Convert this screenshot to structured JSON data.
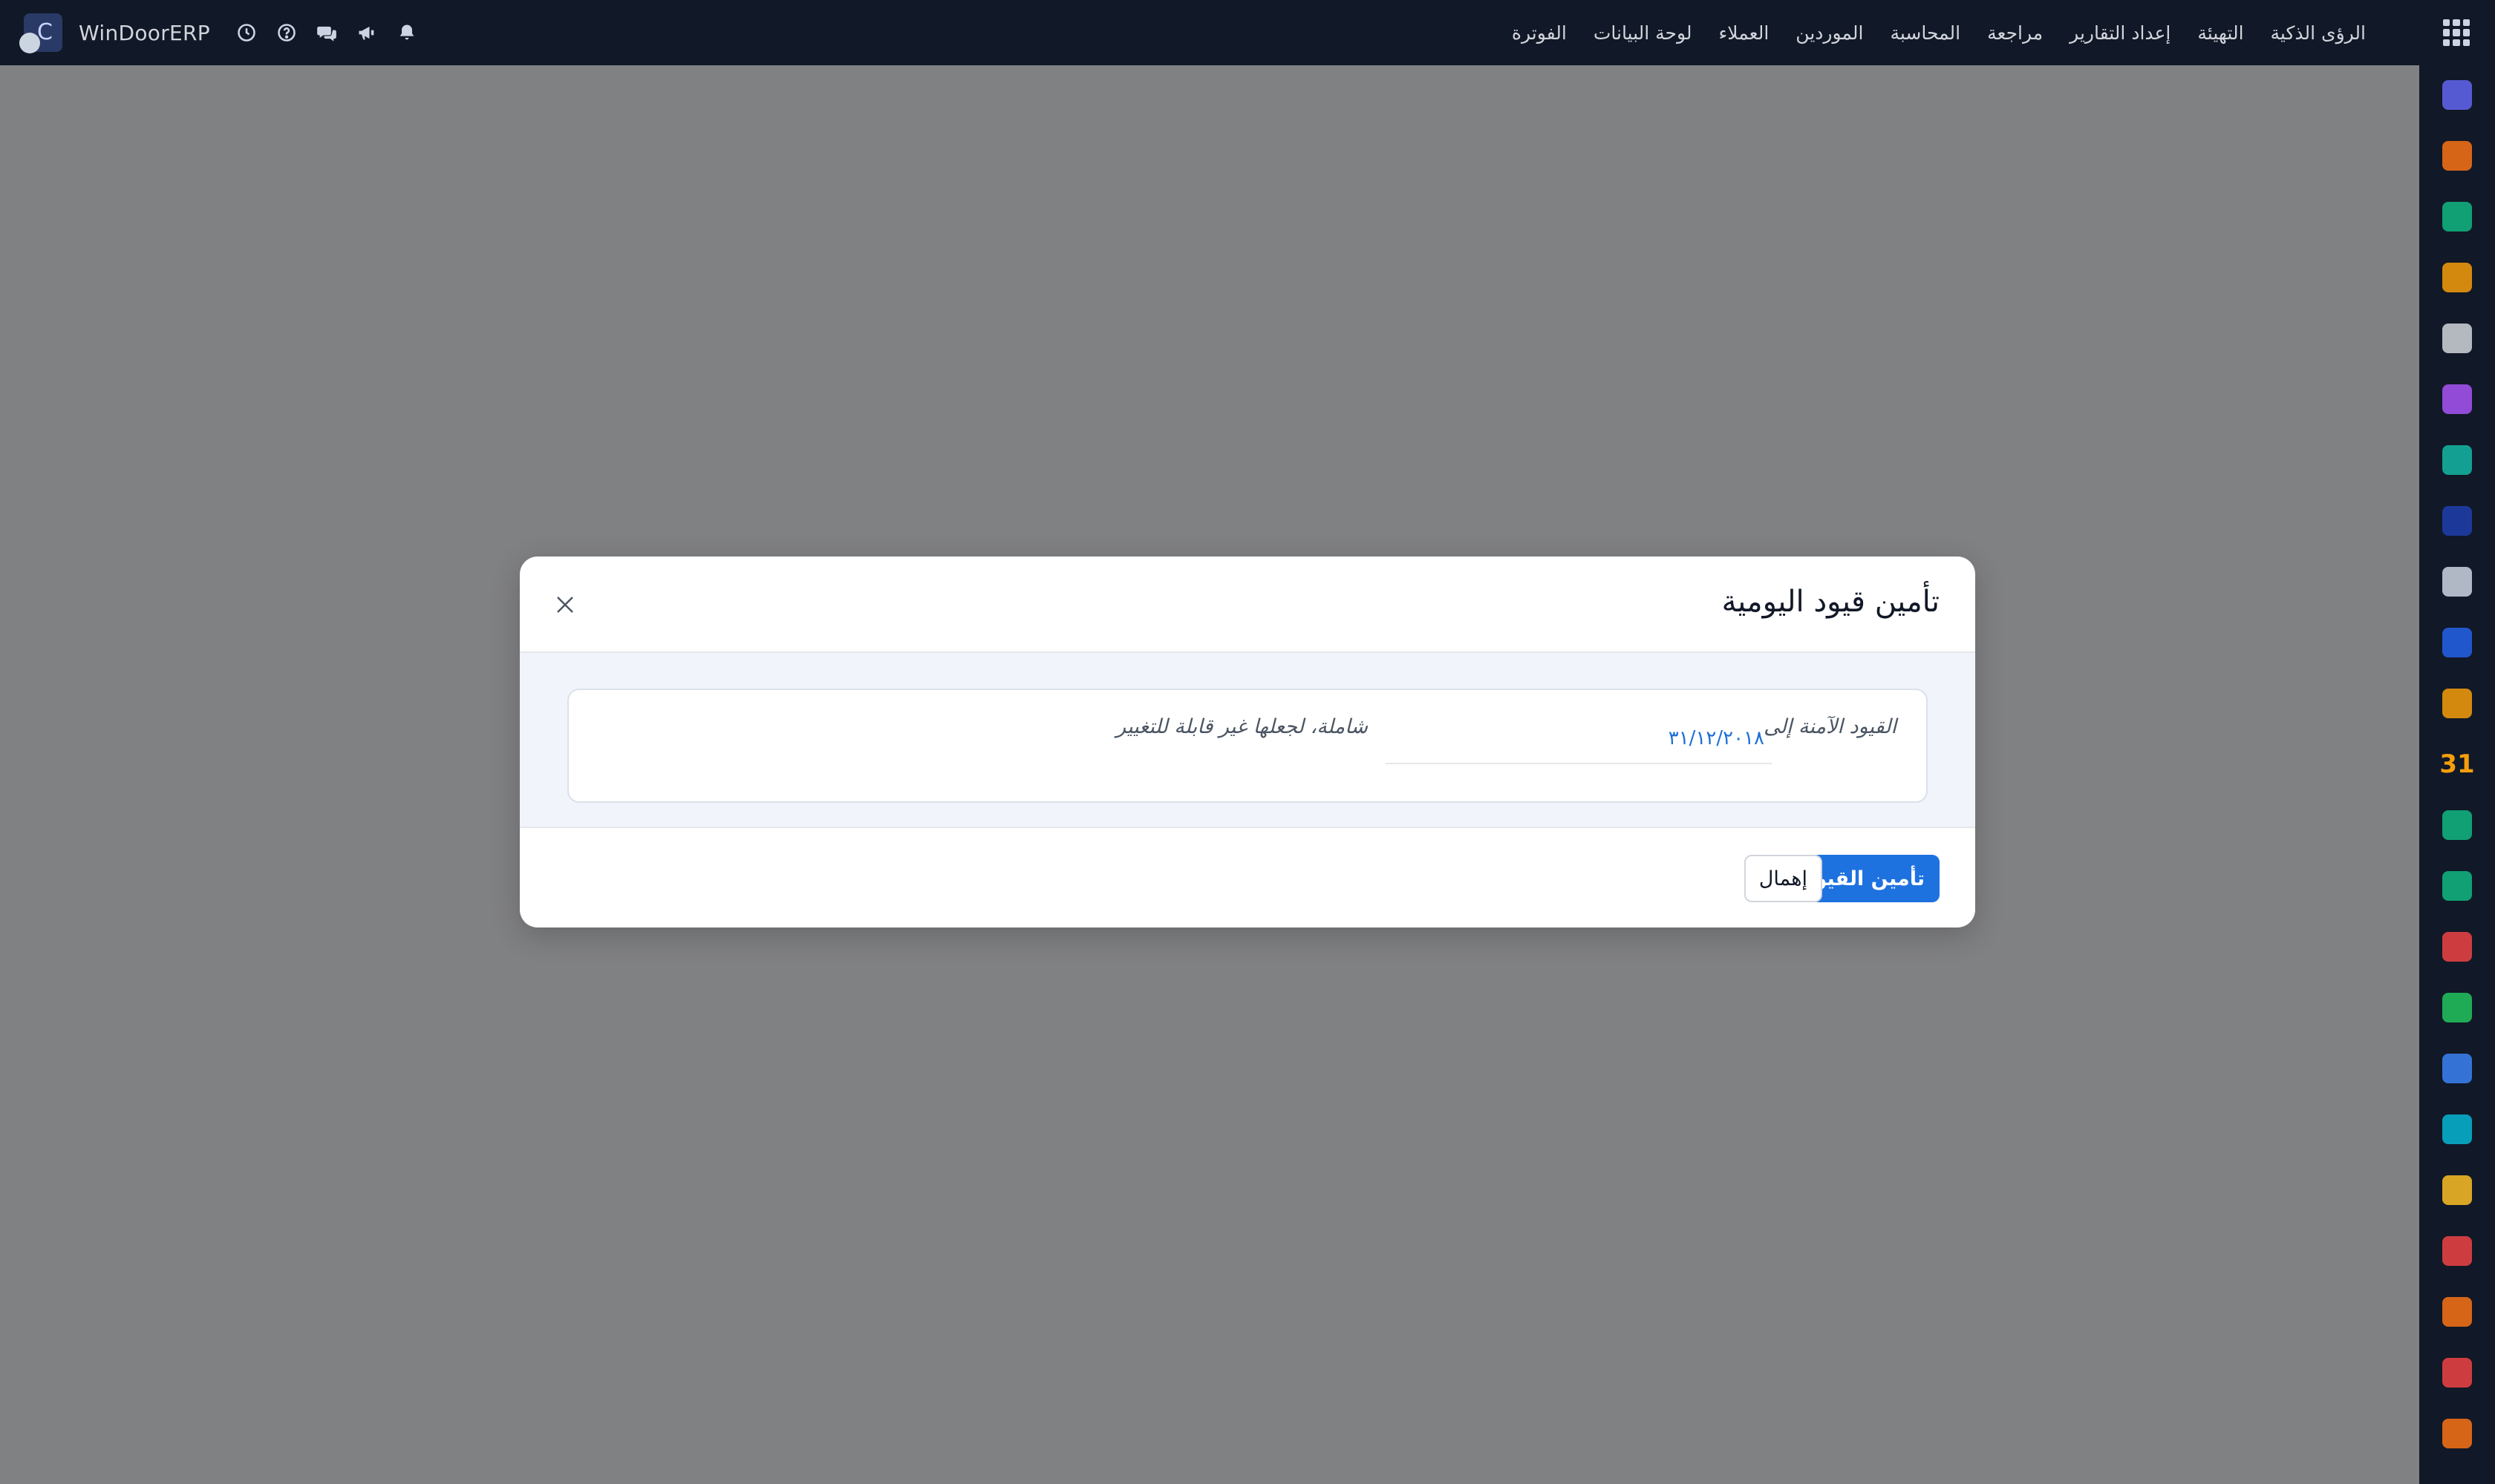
{
  "navbar": {
    "brand": "WinDoorERP",
    "logo_letter": "C",
    "menu": [
      "الفوترة",
      "لوحة البيانات",
      "العملاء",
      "الموردين",
      "المحاسبة",
      "مراجعة",
      "إعداد التقارير",
      "التهيئة",
      "الرؤى الذكية"
    ],
    "icons": [
      "clock-icon",
      "help-icon",
      "chat-icon",
      "megaphone-icon",
      "bell-icon"
    ]
  },
  "sidebar": {
    "apps": [
      {
        "name": "mail-app-icon",
        "color": "#6366f1"
      },
      {
        "name": "discuss-app-icon",
        "color": "#f97316"
      },
      {
        "name": "vip-app-icon",
        "color": "#10b981"
      },
      {
        "name": "reports-app-icon",
        "color": "#f59e0b"
      },
      {
        "name": "inventory-app-icon",
        "color": "#d1d5db"
      },
      {
        "name": "employees-app-icon",
        "color": "#a855f7"
      },
      {
        "name": "tasks-app-icon",
        "color": "#14b8a6"
      },
      {
        "name": "helpdesk-app-icon",
        "color": "#1e40af"
      },
      {
        "name": "package-app-icon",
        "color": "#cbd5e1"
      },
      {
        "name": "documents-app-icon",
        "color": "#2563eb"
      },
      {
        "name": "team-app-icon",
        "color": "#f59e0b"
      },
      {
        "name": "calendar-app-icon",
        "color": "#f59e0b",
        "text": "31"
      },
      {
        "name": "sign-app-icon",
        "color": "#10b981"
      },
      {
        "name": "contacts-app-icon",
        "color": "#10b981"
      },
      {
        "name": "dashboard-app-icon",
        "color": "#ef4444"
      },
      {
        "name": "whatsapp-app-icon",
        "color": "#22c55e"
      },
      {
        "name": "compass-app-icon",
        "color": "#3b82f6"
      },
      {
        "name": "wave-app-icon",
        "color": "#06b6d4"
      },
      {
        "name": "send-app-icon",
        "color": "#fbbf24"
      },
      {
        "name": "kanban-app-icon",
        "color": "#ef4444"
      },
      {
        "name": "box-app-icon",
        "color": "#f97316"
      },
      {
        "name": "pie-app-icon",
        "color": "#ef4444"
      },
      {
        "name": "hexagon-app-icon",
        "color": "#f97316"
      }
    ]
  },
  "modal": {
    "title": "تأمين قيود اليومية",
    "field_label": "القيود الآمنة إلى",
    "field_value": "٣١/١٢/٢٠١٨",
    "field_description": "شاملة، لجعلها غير قابلة للتغيير",
    "primary_button": "تأمين القيود",
    "secondary_button": "إهمال"
  }
}
